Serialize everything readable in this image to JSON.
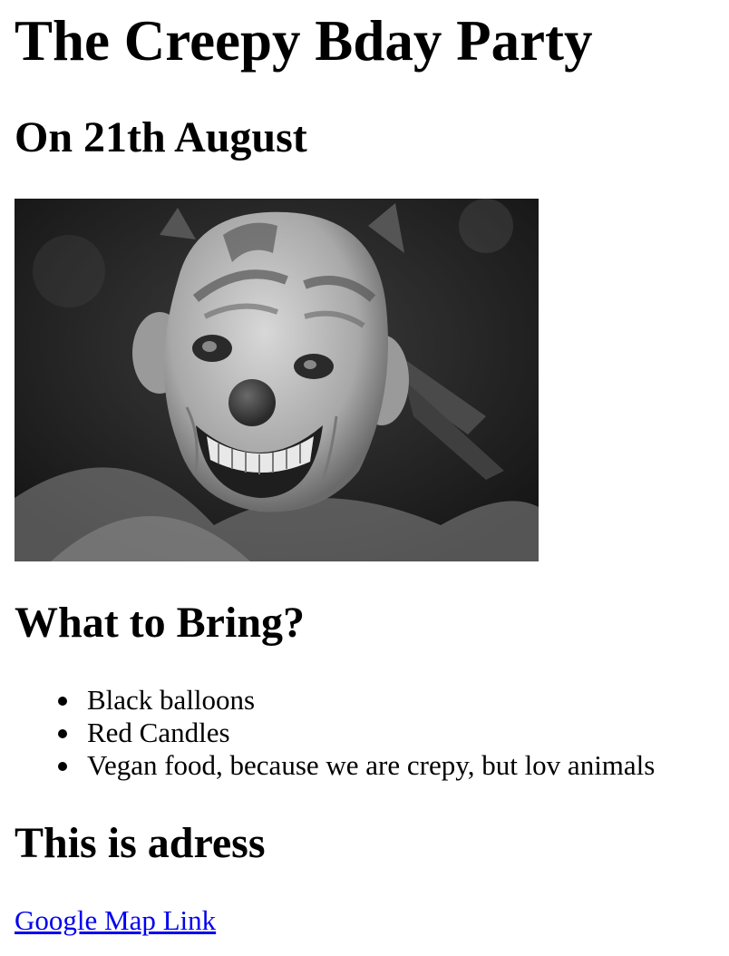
{
  "header": {
    "title": "The Creepy Bday Party",
    "date": "On 21th August"
  },
  "image": {
    "description": "clown-mask-photo",
    "style": "grayscale"
  },
  "bring": {
    "heading": "What to Bring?",
    "items": [
      "Black balloons",
      "Red Candles",
      "Vegan food, because we are crepy, but lov animals"
    ]
  },
  "address": {
    "heading": "This is adress",
    "link_label": "Google Map Link",
    "link_color": "#0000ee"
  }
}
